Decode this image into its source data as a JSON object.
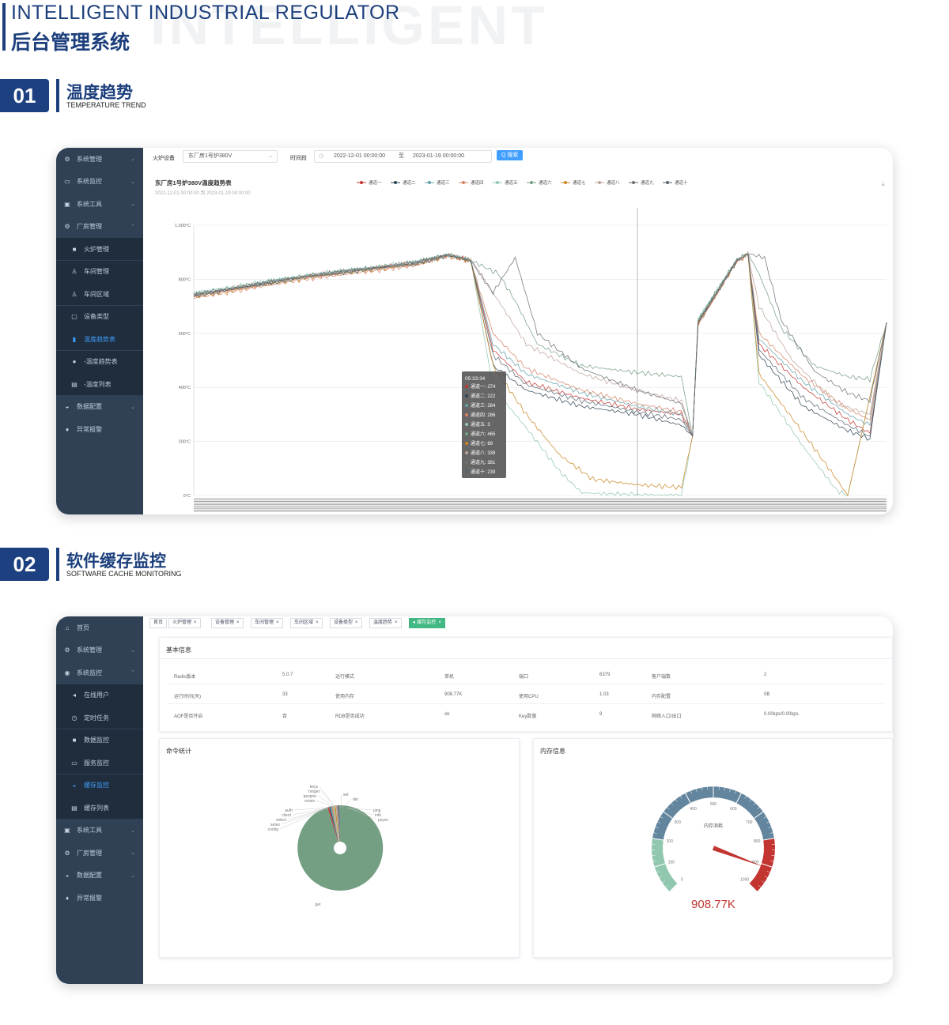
{
  "header": {
    "watermark": "INTELLIGENT",
    "en_title": "INTELLIGENT INDUSTRIAL REGULATOR",
    "cn_title": "后台管理系统"
  },
  "section1": {
    "number": "01",
    "cn": "温度趋势",
    "en": "TEMPERATURE TREND"
  },
  "section2": {
    "number": "02",
    "cn": "软件缓存监控",
    "en": "SOFTWARE CACHE MONITORING"
  },
  "screen1": {
    "sidebar": [
      {
        "icon": "gear-icon",
        "glyph": "⚙",
        "label": "系统管理",
        "level": 0,
        "chevron": "⌄"
      },
      {
        "icon": "monitor-icon",
        "glyph": "▭",
        "label": "系统监控",
        "level": 0,
        "chevron": "⌄"
      },
      {
        "icon": "toolbox-icon",
        "glyph": "▣",
        "label": "系统工具",
        "level": 0,
        "chevron": "⌄"
      },
      {
        "icon": "factory-icon",
        "glyph": "⚙",
        "label": "厂房管理",
        "level": 0,
        "chevron": "⌃",
        "open": true
      },
      {
        "icon": "furnace-icon",
        "glyph": "■",
        "label": "火炉管理",
        "level": 1
      },
      {
        "icon": "workshop-icon",
        "glyph": "♙",
        "label": "车间管理",
        "level": 1
      },
      {
        "icon": "area-icon",
        "glyph": "♙",
        "label": "车间区域",
        "level": 1
      },
      {
        "icon": "device-type-icon",
        "glyph": "▢",
        "label": "设备类型",
        "level": 1
      },
      {
        "icon": "trend-chart-icon",
        "glyph": "▮",
        "label": "温度趋势表",
        "level": 1,
        "active": true
      },
      {
        "icon": "trend-icon",
        "glyph": "●",
        "label": "-温度趋势表",
        "level": 1
      },
      {
        "icon": "list-icon",
        "glyph": "▤",
        "label": "-温度列表",
        "level": 1
      },
      {
        "icon": "database-icon",
        "glyph": "◒",
        "label": "数据配置",
        "level": 0,
        "chevron": "⌄"
      },
      {
        "icon": "alarm-icon",
        "glyph": "♦",
        "label": "异常报警",
        "level": 0
      }
    ],
    "toolbar": {
      "device_label": "火炉设备",
      "device_value": "东厂房1号炉380V",
      "time_label": "时间段",
      "start": "2022-12-01 00:00:00",
      "range_sep": "至",
      "end": "2023-01-19 00:00:00",
      "search_button": "Q 搜索"
    },
    "tooltip": {
      "time": "05:33:34",
      "rows": [
        "通道一: 274",
        "通道二: 222",
        "通道三: 284",
        "通道四: 286",
        "通道五: 3",
        "通道六: 465",
        "通道七: 69",
        "通道八: 339",
        "通道九: 381",
        "通道十: 239"
      ]
    }
  },
  "chart_data": {
    "type": "line",
    "title": "东厂房1号炉380V温度趋势表",
    "subtitle": "2022-12-01 00:00:00 到 2023-01-19 00:00:00",
    "ylabel": "",
    "ylim": [
      0,
      1000
    ],
    "y_ticks": [
      "0°C",
      "200°C",
      "400°C",
      "600°C",
      "800°C",
      "1,000°C"
    ],
    "x_range": [
      0,
      100
    ],
    "x_note": "x tick labels are illegible in the screenshot",
    "legend_position": "top",
    "series": [
      {
        "name": "通道一",
        "color": "#c23531",
        "points": [
          [
            0,
            740
          ],
          [
            20,
            810
          ],
          [
            40,
            860
          ],
          [
            46,
            890
          ],
          [
            50,
            870
          ],
          [
            54,
            540
          ],
          [
            60,
            420
          ],
          [
            70,
            360
          ],
          [
            80,
            320
          ],
          [
            88,
            300
          ],
          [
            90,
            220
          ],
          [
            91,
            640
          ],
          [
            98,
            870
          ],
          [
            100,
            895
          ],
          [
            102,
            560
          ],
          [
            110,
            400
          ],
          [
            118,
            280
          ],
          [
            122,
            230
          ],
          [
            125,
            640
          ]
        ]
      },
      {
        "name": "通道二",
        "color": "#2f4554",
        "points": [
          [
            0,
            740
          ],
          [
            20,
            810
          ],
          [
            40,
            860
          ],
          [
            46,
            890
          ],
          [
            50,
            870
          ],
          [
            54,
            480
          ],
          [
            60,
            390
          ],
          [
            70,
            330
          ],
          [
            80,
            300
          ],
          [
            88,
            260
          ],
          [
            90,
            220
          ],
          [
            91,
            640
          ],
          [
            98,
            870
          ],
          [
            100,
            895
          ],
          [
            102,
            520
          ],
          [
            110,
            330
          ],
          [
            118,
            240
          ],
          [
            122,
            210
          ],
          [
            125,
            640
          ]
        ]
      },
      {
        "name": "通道三",
        "color": "#61a0a8",
        "points": [
          [
            0,
            745
          ],
          [
            20,
            812
          ],
          [
            40,
            862
          ],
          [
            46,
            890
          ],
          [
            50,
            870
          ],
          [
            54,
            560
          ],
          [
            60,
            450
          ],
          [
            70,
            380
          ],
          [
            80,
            330
          ],
          [
            88,
            300
          ],
          [
            90,
            220
          ],
          [
            91,
            650
          ],
          [
            98,
            872
          ],
          [
            100,
            895
          ],
          [
            102,
            580
          ],
          [
            110,
            420
          ],
          [
            118,
            300
          ],
          [
            122,
            260
          ],
          [
            125,
            640
          ]
        ]
      },
      {
        "name": "通道四",
        "color": "#d48265",
        "points": [
          [
            0,
            730
          ],
          [
            20,
            800
          ],
          [
            40,
            850
          ],
          [
            46,
            885
          ],
          [
            50,
            865
          ],
          [
            54,
            600
          ],
          [
            60,
            470
          ],
          [
            70,
            390
          ],
          [
            80,
            340
          ],
          [
            88,
            310
          ],
          [
            90,
            220
          ],
          [
            91,
            630
          ],
          [
            98,
            865
          ],
          [
            100,
            890
          ],
          [
            102,
            600
          ],
          [
            110,
            440
          ],
          [
            118,
            320
          ],
          [
            122,
            280
          ],
          [
            125,
            640
          ]
        ]
      },
      {
        "name": "通道五",
        "color": "#91c7ae",
        "points": [
          [
            0,
            750
          ],
          [
            20,
            815
          ],
          [
            40,
            865
          ],
          [
            46,
            895
          ],
          [
            50,
            870
          ],
          [
            54,
            400
          ],
          [
            60,
            250
          ],
          [
            66,
            90
          ],
          [
            70,
            10
          ],
          [
            80,
            2
          ],
          [
            88,
            2
          ],
          [
            90,
            220
          ],
          [
            91,
            650
          ],
          [
            98,
            875
          ],
          [
            100,
            895
          ],
          [
            102,
            420
          ],
          [
            110,
            180
          ],
          [
            116,
            20
          ],
          [
            118,
            0
          ],
          [
            125,
            640
          ]
        ]
      },
      {
        "name": "通道六",
        "color": "#749f83",
        "points": [
          [
            0,
            745
          ],
          [
            20,
            812
          ],
          [
            40,
            862
          ],
          [
            46,
            892
          ],
          [
            50,
            870
          ],
          [
            55,
            820
          ],
          [
            58,
            720
          ],
          [
            62,
            560
          ],
          [
            70,
            480
          ],
          [
            80,
            455
          ],
          [
            88,
            440
          ],
          [
            90,
            220
          ],
          [
            91,
            650
          ],
          [
            98,
            872
          ],
          [
            100,
            895
          ],
          [
            102,
            820
          ],
          [
            106,
            620
          ],
          [
            112,
            480
          ],
          [
            118,
            440
          ],
          [
            122,
            430
          ],
          [
            125,
            640
          ]
        ]
      },
      {
        "name": "通道七",
        "color": "#ca8622",
        "points": [
          [
            0,
            735
          ],
          [
            20,
            805
          ],
          [
            40,
            855
          ],
          [
            46,
            888
          ],
          [
            50,
            865
          ],
          [
            54,
            480
          ],
          [
            60,
            300
          ],
          [
            66,
            150
          ],
          [
            72,
            60
          ],
          [
            80,
            40
          ],
          [
            88,
            30
          ],
          [
            90,
            220
          ],
          [
            91,
            635
          ],
          [
            98,
            868
          ],
          [
            100,
            890
          ],
          [
            102,
            450
          ],
          [
            110,
            230
          ],
          [
            116,
            60
          ],
          [
            118,
            0
          ],
          [
            125,
            640
          ]
        ]
      },
      {
        "name": "通道八",
        "color": "#bda29a",
        "points": [
          [
            0,
            740
          ],
          [
            20,
            810
          ],
          [
            40,
            860
          ],
          [
            46,
            890
          ],
          [
            50,
            870
          ],
          [
            55,
            720
          ],
          [
            60,
            560
          ],
          [
            70,
            450
          ],
          [
            80,
            390
          ],
          [
            88,
            350
          ],
          [
            90,
            220
          ],
          [
            91,
            640
          ],
          [
            98,
            870
          ],
          [
            100,
            895
          ],
          [
            102,
            700
          ],
          [
            108,
            500
          ],
          [
            116,
            340
          ],
          [
            122,
            300
          ],
          [
            125,
            640
          ]
        ]
      },
      {
        "name": "通道九",
        "color": "#6e7074",
        "points": [
          [
            0,
            742
          ],
          [
            20,
            811
          ],
          [
            40,
            861
          ],
          [
            46,
            891
          ],
          [
            50,
            870
          ],
          [
            54,
            750
          ],
          [
            58,
            880
          ],
          [
            62,
            600
          ],
          [
            70,
            470
          ],
          [
            80,
            390
          ],
          [
            88,
            340
          ],
          [
            90,
            220
          ],
          [
            91,
            640
          ],
          [
            98,
            870
          ],
          [
            100,
            895
          ],
          [
            103,
            880
          ],
          [
            106,
            650
          ],
          [
            112,
            460
          ],
          [
            118,
            380
          ],
          [
            122,
            350
          ],
          [
            125,
            640
          ]
        ]
      },
      {
        "name": "通道十",
        "color": "#546570",
        "points": [
          [
            0,
            740
          ],
          [
            20,
            808
          ],
          [
            40,
            858
          ],
          [
            46,
            888
          ],
          [
            50,
            868
          ],
          [
            54,
            520
          ],
          [
            60,
            410
          ],
          [
            70,
            350
          ],
          [
            80,
            310
          ],
          [
            88,
            280
          ],
          [
            90,
            220
          ],
          [
            91,
            640
          ],
          [
            98,
            868
          ],
          [
            100,
            893
          ],
          [
            102,
            540
          ],
          [
            110,
            360
          ],
          [
            118,
            260
          ],
          [
            122,
            220
          ],
          [
            125,
            640
          ]
        ]
      }
    ]
  },
  "screen2": {
    "sidebar": [
      {
        "icon": "home-icon",
        "glyph": "⌂",
        "label": "首页",
        "level": 0
      },
      {
        "icon": "gear-icon",
        "glyph": "⚙",
        "label": "系统管理",
        "level": 0,
        "chevron": "⌄"
      },
      {
        "icon": "monitor-icon",
        "glyph": "◉",
        "label": "系统监控",
        "level": 0,
        "chevron": "⌃",
        "open": true
      },
      {
        "icon": "online-user-icon",
        "glyph": "◂",
        "label": "在线用户",
        "level": 1
      },
      {
        "icon": "job-icon",
        "glyph": "◷",
        "label": "定时任务",
        "level": 1
      },
      {
        "icon": "data-monitor-icon",
        "glyph": "■",
        "label": "数据监控",
        "level": 1
      },
      {
        "icon": "server-icon",
        "glyph": "▭",
        "label": "服务监控",
        "level": 1
      },
      {
        "icon": "cache-icon",
        "glyph": "◒",
        "label": "缓存监控",
        "level": 1,
        "active": true
      },
      {
        "icon": "cache-list-icon",
        "glyph": "▤",
        "label": "缓存列表",
        "level": 1
      },
      {
        "icon": "tools-icon",
        "glyph": "▣",
        "label": "系统工具",
        "level": 0,
        "chevron": "⌄"
      },
      {
        "icon": "factory-icon",
        "glyph": "⚙",
        "label": "厂房管理",
        "level": 0,
        "chevron": "⌄"
      },
      {
        "icon": "database-icon",
        "glyph": "◒",
        "label": "数据配置",
        "level": 0,
        "chevron": "⌄"
      },
      {
        "icon": "alarm-icon",
        "glyph": "♦",
        "label": "异常报警",
        "level": 0
      }
    ],
    "tabs": [
      {
        "label": "首页",
        "close": ""
      },
      {
        "label": "火炉管理",
        "close": "×"
      },
      {
        "label": "设备管理",
        "close": "×"
      },
      {
        "label": "车间管理",
        "close": "×"
      },
      {
        "label": "车间区域",
        "close": "×"
      },
      {
        "label": "设备类型",
        "close": "×"
      },
      {
        "label": "温度趋势",
        "close": "×"
      },
      {
        "label": "缓存监控",
        "close": "×",
        "active": true
      }
    ],
    "basic_info": {
      "title": "基本信息",
      "rows": [
        [
          "Redis版本",
          "5.0.7",
          "运行模式",
          "单机",
          "端口",
          "6379",
          "客户端数",
          "2"
        ],
        [
          "运行时间(天)",
          "33",
          "使用内存",
          "908.77K",
          "使用CPU",
          "1.03",
          "内存配置",
          "0B"
        ],
        [
          "AOF是否开启",
          "否",
          "RDB是否成功",
          "ok",
          "Key数量",
          "9",
          "网络入口/出口",
          "0.00kps/0.00kps"
        ]
      ]
    },
    "command_stats": {
      "title": "命令统计",
      "labels": [
        "keys",
        "hmget",
        "pexpire",
        "exists",
        "set",
        "del",
        "auth",
        "client",
        "select",
        "setex",
        "ping",
        "info",
        "config",
        "psync",
        "get"
      ]
    },
    "memory": {
      "title": "内存信息",
      "gauge_label": "内存消耗",
      "value": "908.77K",
      "value_percent": 0.909,
      "ticks": [
        "0",
        "100",
        "200",
        "300",
        "400",
        "500",
        "600",
        "700",
        "800",
        "900",
        "1000"
      ]
    }
  }
}
